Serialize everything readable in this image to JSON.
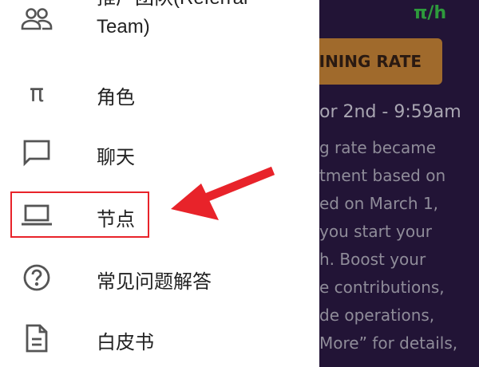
{
  "background_screen": {
    "unit": "π/h",
    "button_label": "INING RATE",
    "date_text": "or 2nd - 9:59am",
    "text_lines": [
      "g rate became",
      "tment based on",
      "ed on March 1,",
      " you start your",
      "h. Boost your",
      "e contributions,",
      "de operations,",
      "More” for details,"
    ]
  },
  "drawer": {
    "items": [
      {
        "id": "team",
        "label": "推广团队(Referral Team)",
        "icon": "people-icon"
      },
      {
        "id": "roles",
        "label": "角色",
        "icon": "pi-icon",
        "icon_glyph": "π"
      },
      {
        "id": "chat",
        "label": "聊天",
        "icon": "chat-bubble-icon"
      },
      {
        "id": "nodes",
        "label": "节点",
        "icon": "laptop-icon",
        "highlighted": true
      },
      {
        "id": "faq",
        "label": "常见问题解答",
        "icon": "help-circle-icon"
      },
      {
        "id": "whitepaper",
        "label": "白皮书",
        "icon": "document-icon"
      }
    ]
  },
  "annotation": {
    "highlight_color": "#e8232a",
    "arrow_color": "#e8232a"
  }
}
